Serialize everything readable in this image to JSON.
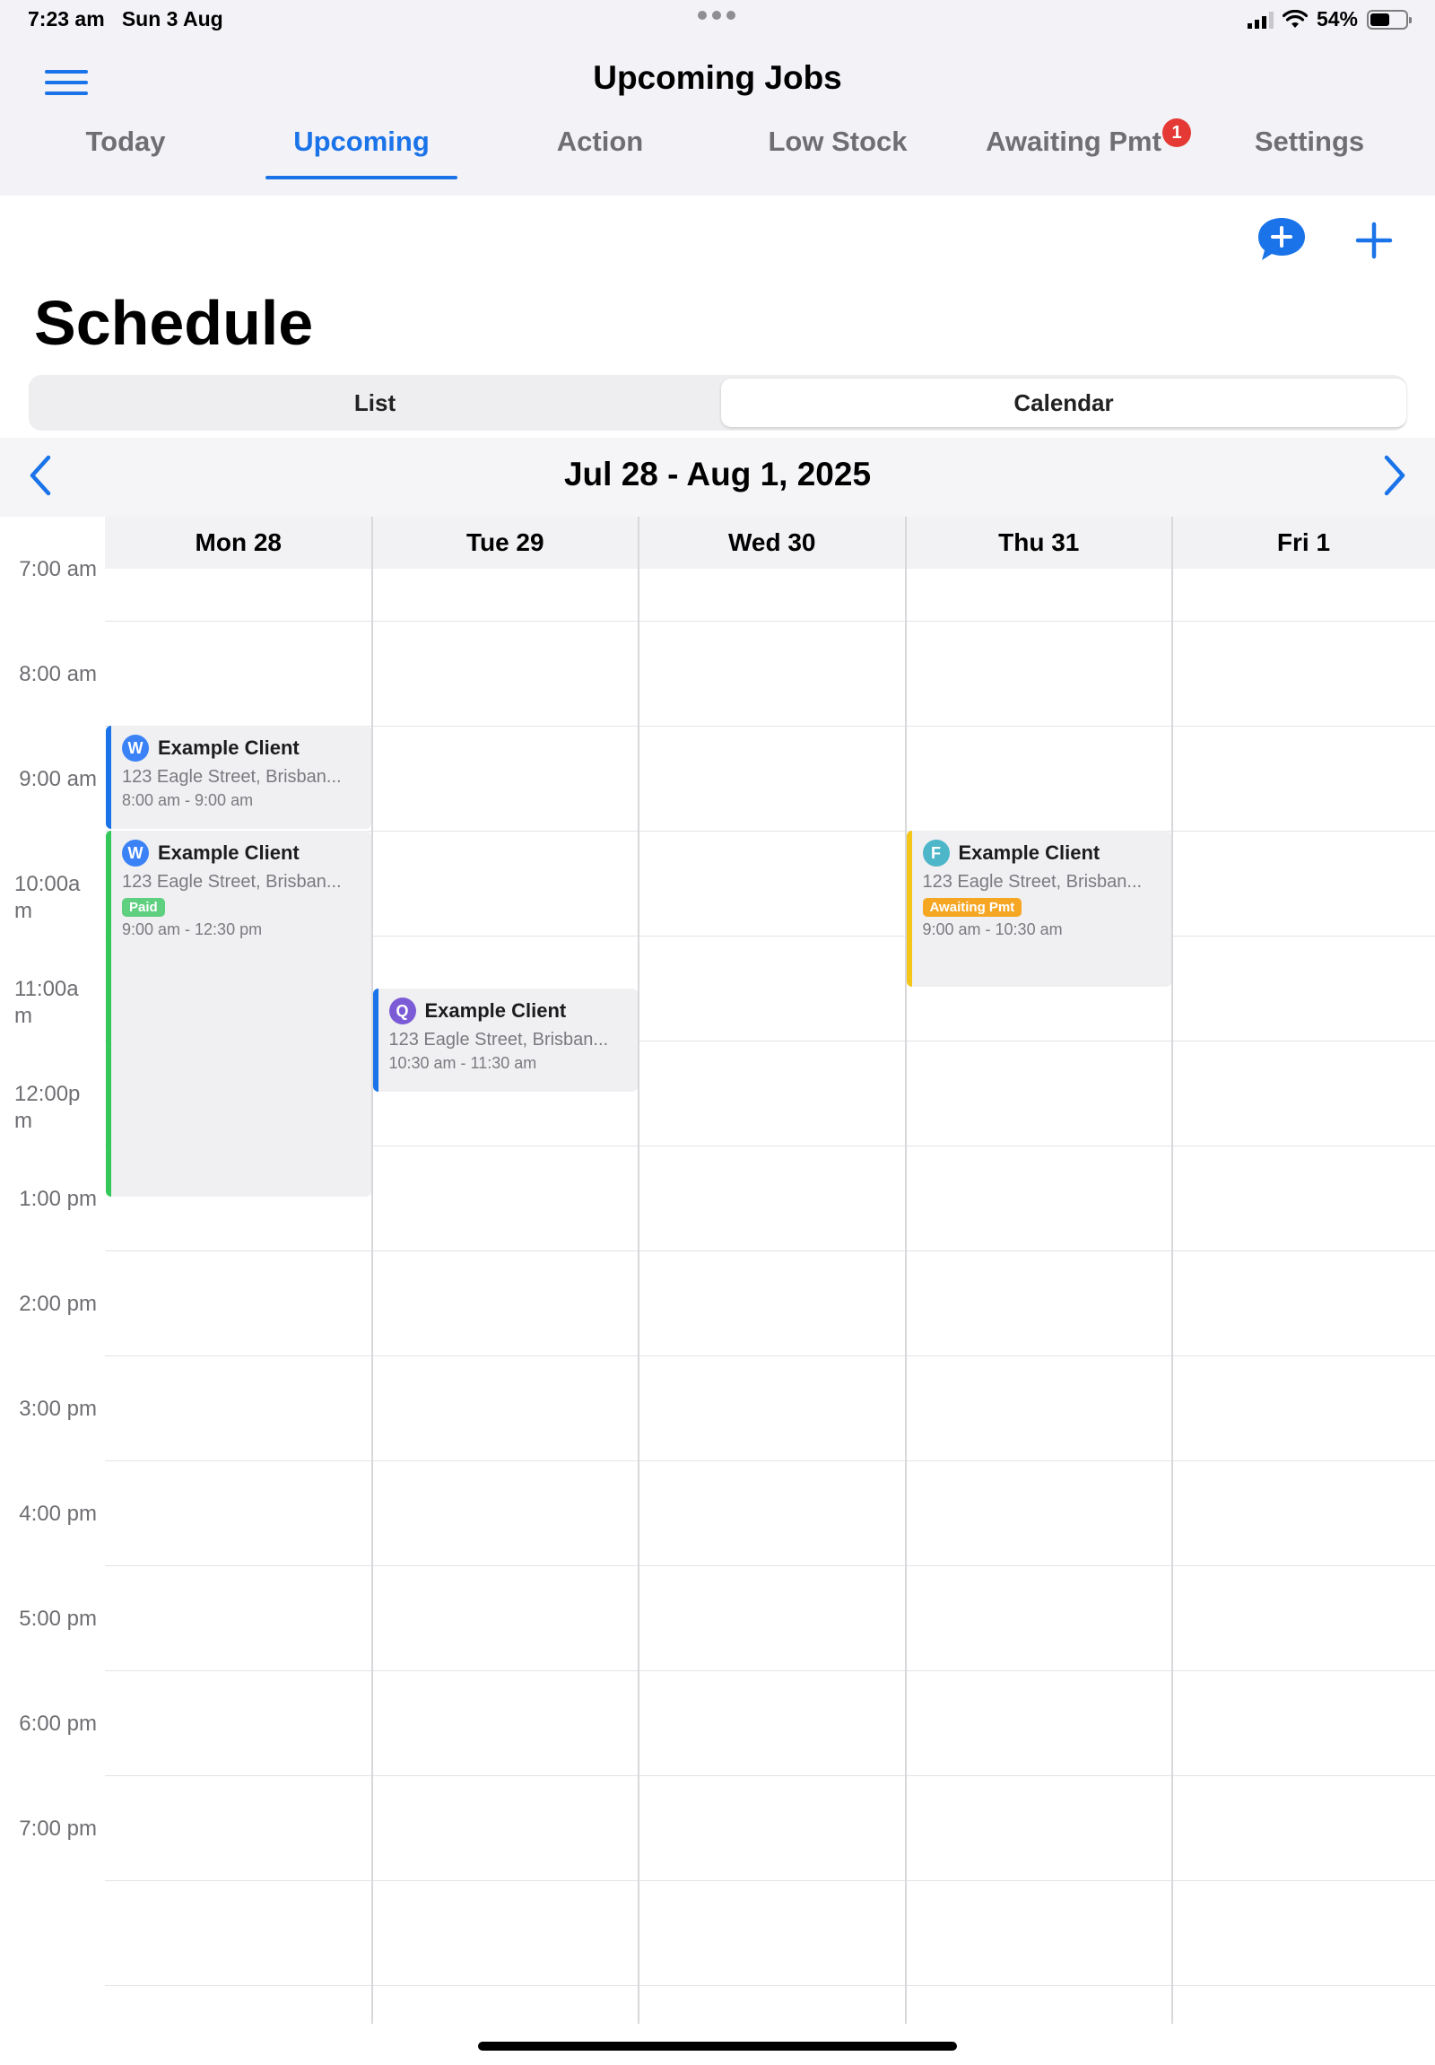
{
  "status_bar": {
    "time": "7:23 am",
    "date": "Sun 3 Aug",
    "battery": "54%",
    "battery_level": 0.54
  },
  "header": {
    "title": "Upcoming Jobs",
    "tabs": [
      {
        "label": "Today",
        "active": false
      },
      {
        "label": "Upcoming",
        "active": true
      },
      {
        "label": "Action",
        "active": false
      },
      {
        "label": "Low Stock",
        "active": false
      },
      {
        "label": "Awaiting Pmt",
        "active": false,
        "badge": "1"
      },
      {
        "label": "Settings",
        "active": false
      }
    ]
  },
  "page": {
    "title": "Schedule",
    "view_toggle": {
      "list": "List",
      "calendar": "Calendar",
      "selected": "Calendar"
    }
  },
  "calendar": {
    "range": "Jul 28 - Aug 1, 2025",
    "days": [
      "Mon 28",
      "Tue 29",
      "Wed 30",
      "Thu 31",
      "Fri 1"
    ],
    "times": [
      "7:00 am",
      "8:00 am",
      "9:00 am",
      "10:00 am",
      "11:00 am",
      "12:00 pm",
      "1:00 pm",
      "2:00 pm",
      "3:00 pm",
      "4:00 pm",
      "5:00 pm",
      "6:00 pm",
      "7:00 pm"
    ],
    "events": [
      {
        "day": 0,
        "initial": "W",
        "avatar_color": "#3b82f6",
        "accent": "#1a73e8",
        "client": "Example Client",
        "address": "123 Eagle Street, Brisban...",
        "tag": "",
        "time": "8:00 am - 9:00 am"
      },
      {
        "day": 0,
        "initial": "W",
        "avatar_color": "#3b82f6",
        "accent": "#34c759",
        "client": "Example Client",
        "address": "123 Eagle Street, Brisban...",
        "tag": "Paid",
        "tag_color": "#5fcf80",
        "time": "9:00 am - 12:30 pm"
      },
      {
        "day": 1,
        "initial": "Q",
        "avatar_color": "#7c5cd6",
        "accent": "#1a73e8",
        "client": "Example Client",
        "address": "123 Eagle Street, Brisban...",
        "tag": "",
        "time": "10:30 am - 11:30 am"
      },
      {
        "day": 3,
        "initial": "F",
        "avatar_color": "#4db6c9",
        "accent": "#f5c518",
        "client": "Example Client",
        "address": "123 Eagle Street, Brisban...",
        "tag": "Awaiting Pmt",
        "tag_color": "#f5a623",
        "time": "9:00 am - 10:30 am"
      }
    ]
  },
  "colors": {
    "accent": "#1a73e8",
    "badge": "#e53935"
  }
}
